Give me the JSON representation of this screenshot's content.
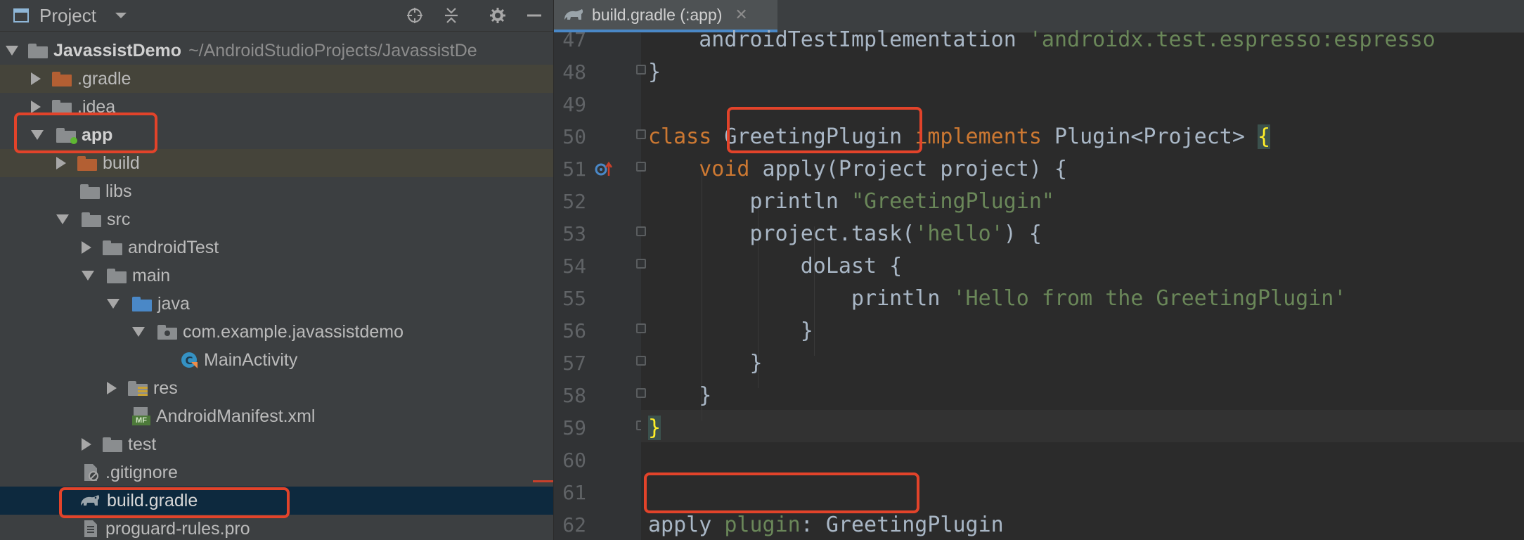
{
  "project_panel": {
    "title": "Project",
    "tree": [
      {
        "label": "JavassistDemo",
        "path": "~/AndroidStudioProjects/JavassistDe"
      },
      {
        "label": ".gradle"
      },
      {
        "label": ".idea"
      },
      {
        "label": "app"
      },
      {
        "label": "build"
      },
      {
        "label": "libs"
      },
      {
        "label": "src"
      },
      {
        "label": "androidTest"
      },
      {
        "label": "main"
      },
      {
        "label": "java"
      },
      {
        "label": "com.example.javassistdemo"
      },
      {
        "label": "MainActivity"
      },
      {
        "label": "res"
      },
      {
        "label": "AndroidManifest.xml"
      },
      {
        "label": "test"
      },
      {
        "label": ".gitignore"
      },
      {
        "label": "build.gradle"
      },
      {
        "label": "proguard-rules.pro"
      }
    ],
    "manifest_badge": "MF"
  },
  "editor": {
    "tab_label": "build.gradle (:app)",
    "tab_close": "✕",
    "line_numbers": [
      "47",
      "48",
      "49",
      "50",
      "51",
      "52",
      "53",
      "54",
      "55",
      "56",
      "57",
      "58",
      "59",
      "60",
      "61",
      "62"
    ],
    "code": {
      "l47_a": "    androidTestImplementation ",
      "l47_b": "'androidx.test.espresso:espresso",
      "l48": "}",
      "l50_kw": "class",
      "l50_name": "GreetingPlugin",
      "l50_kw2": "implements",
      "l50_type": " Plugin<Project> ",
      "l50_brace": "{",
      "l51_kw": "    void",
      "l51_rest": " apply(Project project) {",
      "l52_a": "        println ",
      "l52_str": "\"GreetingPlugin\"",
      "l53_a": "        project.task(",
      "l53_str": "'hello'",
      "l53_b": ") {",
      "l54": "            doLast {",
      "l55_a": "                println ",
      "l55_str": "'Hello from the GreetingPlugin'",
      "l56": "            }",
      "l57": "        }",
      "l58": "    }",
      "l59_brace": "}",
      "l61_a": "apply ",
      "l61_plugin": "plugin",
      "l61_b": ": GreetingPlugin"
    }
  },
  "colors": {
    "highlight_box": "#e2432a",
    "keyword": "#cc7832",
    "string": "#6a8759",
    "selection": "#0d293e"
  }
}
